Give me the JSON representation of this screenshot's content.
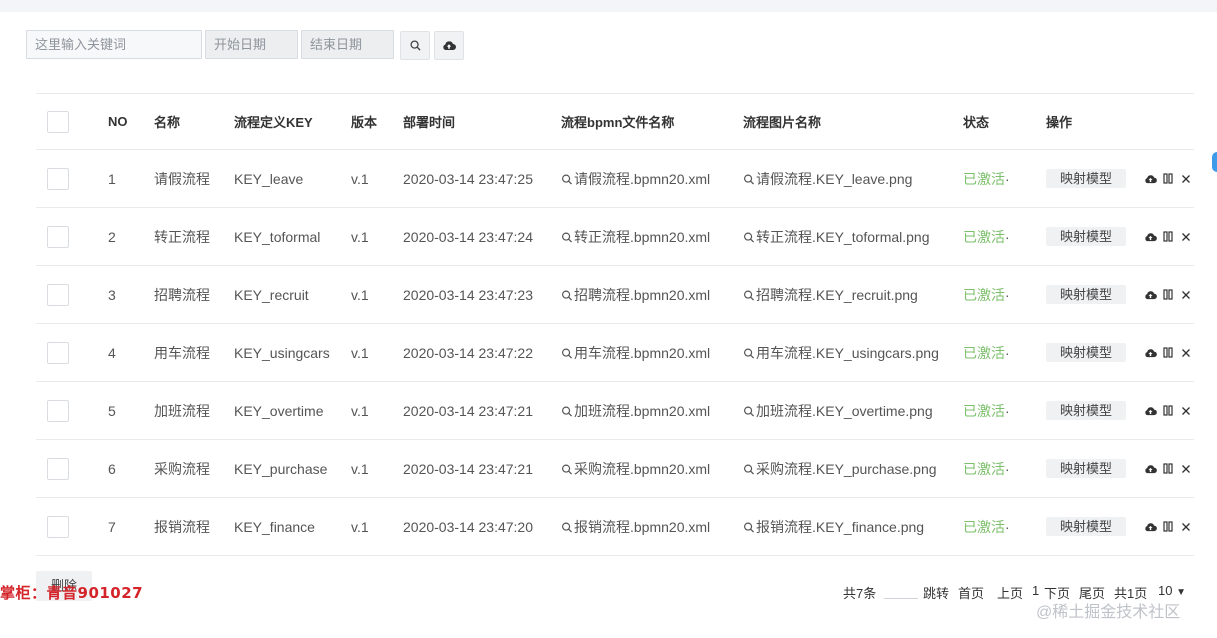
{
  "search": {
    "keyword_placeholder": "这里输入关键词",
    "start_date_placeholder": "开始日期",
    "end_date_placeholder": "结束日期"
  },
  "table": {
    "headers": {
      "no": "NO",
      "name": "名称",
      "key": "流程定义KEY",
      "version": "版本",
      "deploy_time": "部署时间",
      "bpmn_file": "流程bpmn文件名称",
      "image_file": "流程图片名称",
      "status": "状态",
      "actions": "操作"
    },
    "rows": [
      {
        "no": "1",
        "name": "请假流程",
        "key": "KEY_leave",
        "version": "v.1",
        "deploy_time": "2020-03-14 23:47:25",
        "bpmn_file": "请假流程.bpmn20.xml",
        "image_file": "请假流程.KEY_leave.png",
        "status": "已激活",
        "map_label": "映射模型"
      },
      {
        "no": "2",
        "name": "转正流程",
        "key": "KEY_toformal",
        "version": "v.1",
        "deploy_time": "2020-03-14 23:47:24",
        "bpmn_file": "转正流程.bpmn20.xml",
        "image_file": "转正流程.KEY_toformal.png",
        "status": "已激活",
        "map_label": "映射模型"
      },
      {
        "no": "3",
        "name": "招聘流程",
        "key": "KEY_recruit",
        "version": "v.1",
        "deploy_time": "2020-03-14 23:47:23",
        "bpmn_file": "招聘流程.bpmn20.xml",
        "image_file": "招聘流程.KEY_recruit.png",
        "status": "已激活",
        "map_label": "映射模型"
      },
      {
        "no": "4",
        "name": "用车流程",
        "key": "KEY_usingcars",
        "version": "v.1",
        "deploy_time": "2020-03-14 23:47:22",
        "bpmn_file": "用车流程.bpmn20.xml",
        "image_file": "用车流程.KEY_usingcars.png",
        "status": "已激活",
        "map_label": "映射模型"
      },
      {
        "no": "5",
        "name": "加班流程",
        "key": "KEY_overtime",
        "version": "v.1",
        "deploy_time": "2020-03-14 23:47:21",
        "bpmn_file": "加班流程.bpmn20.xml",
        "image_file": "加班流程.KEY_overtime.png",
        "status": "已激活",
        "map_label": "映射模型"
      },
      {
        "no": "6",
        "name": "采购流程",
        "key": "KEY_purchase",
        "version": "v.1",
        "deploy_time": "2020-03-14 23:47:21",
        "bpmn_file": "采购流程.bpmn20.xml",
        "image_file": "采购流程.KEY_purchase.png",
        "status": "已激活",
        "map_label": "映射模型"
      },
      {
        "no": "7",
        "name": "报销流程",
        "key": "KEY_finance",
        "version": "v.1",
        "deploy_time": "2020-03-14 23:47:20",
        "bpmn_file": "报销流程.bpmn20.xml",
        "image_file": "报销流程.KEY_finance.png",
        "status": "已激活",
        "map_label": "映射模型"
      }
    ]
  },
  "footer": {
    "delete_label": "删除",
    "shopkeeper": "掌柜：青音901027",
    "total": "共7条",
    "jump": "跳转",
    "first": "首页",
    "prev": "上页",
    "current": "1",
    "next": "下页",
    "last": "尾页",
    "pages": "共1页",
    "page_size": "10",
    "page_size_caret": "▼"
  },
  "watermark": "@稀土掘金技术社区",
  "colors": {
    "status_active": "#7bbf6a",
    "shopkeeper_text": "#d4242a",
    "edge_accent": "#3d9be9"
  }
}
